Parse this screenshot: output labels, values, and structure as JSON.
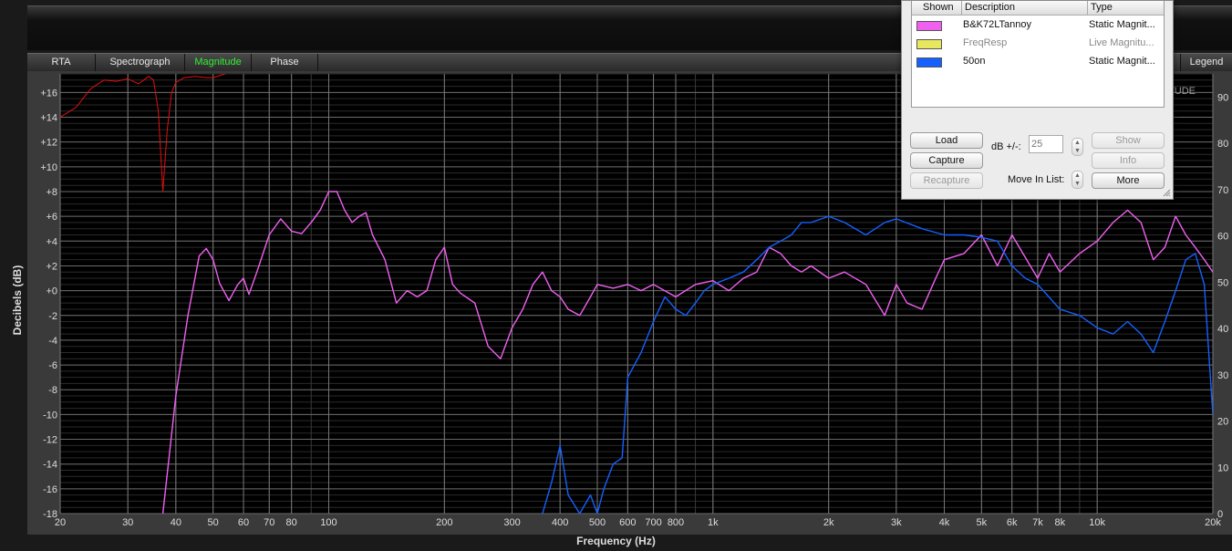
{
  "tabs": [
    "RTA",
    "Spectrograph",
    "Magnitude",
    "Phase"
  ],
  "active_tab": "Magnitude",
  "legend_button": "Legend",
  "corner_label": "ITUDE",
  "panel": {
    "headers": {
      "shown": "Shown",
      "description": "Description",
      "type": "Type"
    },
    "rows": [
      {
        "description": "B&K72LTannoy",
        "type": "Static Magnit...",
        "color": "#f060f0",
        "dimmed": false
      },
      {
        "description": "FreqResp",
        "type": "Live Magnitu...",
        "color": "#e8e860",
        "dimmed": true
      },
      {
        "description": "50on",
        "type": "Static Magnit...",
        "color": "#1560ff",
        "dimmed": false
      }
    ],
    "load": "Load",
    "capture": "Capture",
    "recapture": "Recapture",
    "db_label": "dB +/-:",
    "db_value": "25",
    "move_label": "Move In List:",
    "show": "Show",
    "info": "Info",
    "more": "More"
  },
  "chart_data": {
    "type": "line",
    "xlabel": "Frequency (Hz)",
    "ylabel": "Decibels (dB)",
    "x_scale": "log",
    "xlim": [
      20,
      20000
    ],
    "ylim": [
      -18,
      17.5
    ],
    "y2lim": [
      0,
      95
    ],
    "grid": true,
    "x_ticks": [
      20,
      30,
      40,
      50,
      60,
      70,
      80,
      100,
      200,
      300,
      400,
      500,
      600,
      700,
      800,
      1000,
      2000,
      3000,
      4000,
      5000,
      6000,
      7000,
      8000,
      10000,
      20000
    ],
    "x_tick_labels": [
      "20",
      "30",
      "40",
      "50",
      "60",
      "70",
      "80",
      "100",
      "200",
      "300",
      "400",
      "500",
      "600",
      "700",
      "800",
      "1k",
      "2k",
      "3k",
      "4k",
      "5k",
      "6k",
      "7k",
      "8k",
      "10k",
      "20k"
    ],
    "y_ticks": [
      16,
      14,
      12,
      10,
      8,
      6,
      4,
      2,
      0,
      -2,
      -4,
      -6,
      -8,
      -10,
      -12,
      -14,
      -16,
      -18
    ],
    "y_tick_labels": [
      "+16",
      "+14",
      "+12",
      "+10",
      "+8",
      "+6",
      "+4",
      "+2",
      "+0",
      "-2",
      "-4",
      "-6",
      "-8",
      "-10",
      "-12",
      "-14",
      "-16",
      "-18"
    ],
    "y2_ticks": [
      90,
      80,
      70,
      60,
      50,
      40,
      30,
      20,
      10,
      0
    ],
    "y2_tick_labels": [
      "90",
      "80",
      "70",
      "60",
      "50",
      "40",
      "30",
      "20",
      "10",
      "0"
    ],
    "series": [
      {
        "color": "#e01010",
        "x": [
          20,
          22,
          24,
          26,
          28,
          30,
          32,
          34,
          35,
          36,
          37,
          38,
          39,
          40,
          42,
          45,
          48,
          50,
          55,
          60,
          70,
          80,
          100,
          200,
          500,
          1000,
          2000,
          5000,
          10000,
          20000
        ],
        "y": [
          14.0,
          14.8,
          16.3,
          17.0,
          16.9,
          17.1,
          16.7,
          17.3,
          17.0,
          14.5,
          8.0,
          13.0,
          16.0,
          16.8,
          17.2,
          17.3,
          17.2,
          17.2,
          17.6,
          17.6,
          17.7,
          17.7,
          17.7,
          17.6,
          17.6,
          17.6,
          17.6,
          17.5,
          17.5,
          17.6
        ]
      },
      {
        "color": "#f060f0",
        "x": [
          37,
          40,
          43,
          46,
          48,
          50,
          52,
          55,
          58,
          60,
          62,
          65,
          70,
          75,
          80,
          85,
          90,
          95,
          100,
          105,
          110,
          115,
          120,
          125,
          130,
          140,
          150,
          160,
          170,
          180,
          190,
          200,
          210,
          220,
          240,
          260,
          280,
          300,
          320,
          340,
          360,
          380,
          400,
          420,
          450,
          480,
          500,
          550,
          600,
          650,
          700,
          800,
          900,
          1000,
          1100,
          1200,
          1300,
          1400,
          1500,
          1600,
          1700,
          1800,
          2000,
          2200,
          2500,
          2800,
          3000,
          3200,
          3500,
          3800,
          4000,
          4500,
          5000,
          5500,
          6000,
          7000,
          7500,
          8000,
          9000,
          10000,
          11000,
          12000,
          13000,
          14000,
          15000,
          16000,
          17000,
          18000,
          19000,
          20000
        ],
        "y": [
          -18,
          -8.5,
          -2.0,
          2.8,
          3.4,
          2.5,
          0.6,
          -0.8,
          0.5,
          1.0,
          -0.3,
          1.5,
          4.5,
          5.8,
          4.8,
          4.6,
          5.5,
          6.5,
          8.0,
          8.0,
          6.5,
          5.5,
          6.0,
          6.3,
          4.5,
          2.5,
          -1.0,
          0.0,
          -0.5,
          0.0,
          2.5,
          3.5,
          0.5,
          -0.2,
          -1.0,
          -4.5,
          -5.5,
          -3.0,
          -1.5,
          0.5,
          1.5,
          0.0,
          -0.5,
          -1.5,
          -2.0,
          -0.5,
          0.5,
          0.2,
          0.5,
          0.0,
          0.5,
          -0.5,
          0.5,
          0.8,
          0.0,
          1.0,
          1.5,
          3.5,
          3.0,
          2.0,
          1.5,
          2.0,
          1.0,
          1.5,
          0.5,
          -2.0,
          0.5,
          -1.0,
          -1.5,
          1.0,
          2.5,
          3.0,
          4.5,
          2.0,
          4.5,
          1.0,
          3.0,
          1.5,
          3.0,
          4.0,
          5.5,
          6.5,
          5.5,
          2.5,
          3.5,
          6.0,
          4.5,
          3.5,
          2.5,
          1.5
        ]
      },
      {
        "color": "#1560ff",
        "x": [
          360,
          380,
          400,
          420,
          450,
          480,
          500,
          520,
          550,
          580,
          600,
          650,
          700,
          750,
          800,
          850,
          900,
          950,
          1000,
          1100,
          1200,
          1300,
          1400,
          1500,
          1600,
          1700,
          1800,
          2000,
          2200,
          2500,
          2800,
          3000,
          3500,
          4000,
          4500,
          5000,
          5500,
          6000,
          6500,
          7000,
          8000,
          9000,
          10000,
          11000,
          12000,
          13000,
          14000,
          15000,
          16000,
          17000,
          18000,
          19000,
          20000
        ],
        "y": [
          -18,
          -15.5,
          -12.5,
          -16.5,
          -18,
          -16.5,
          -18,
          -16.0,
          -14.0,
          -13.5,
          -7.0,
          -5.0,
          -2.5,
          -0.5,
          -1.5,
          -2.0,
          -1.0,
          0.0,
          0.5,
          1.0,
          1.5,
          2.5,
          3.5,
          4.0,
          4.5,
          5.5,
          5.5,
          6.0,
          5.5,
          4.5,
          5.5,
          5.8,
          5.0,
          4.5,
          4.5,
          4.3,
          4.0,
          2.0,
          1.0,
          0.5,
          -1.5,
          -2.0,
          -3.0,
          -3.5,
          -2.5,
          -3.5,
          -5.0,
          -2.5,
          0.0,
          2.5,
          3.0,
          0.5,
          -10.0
        ]
      }
    ]
  }
}
